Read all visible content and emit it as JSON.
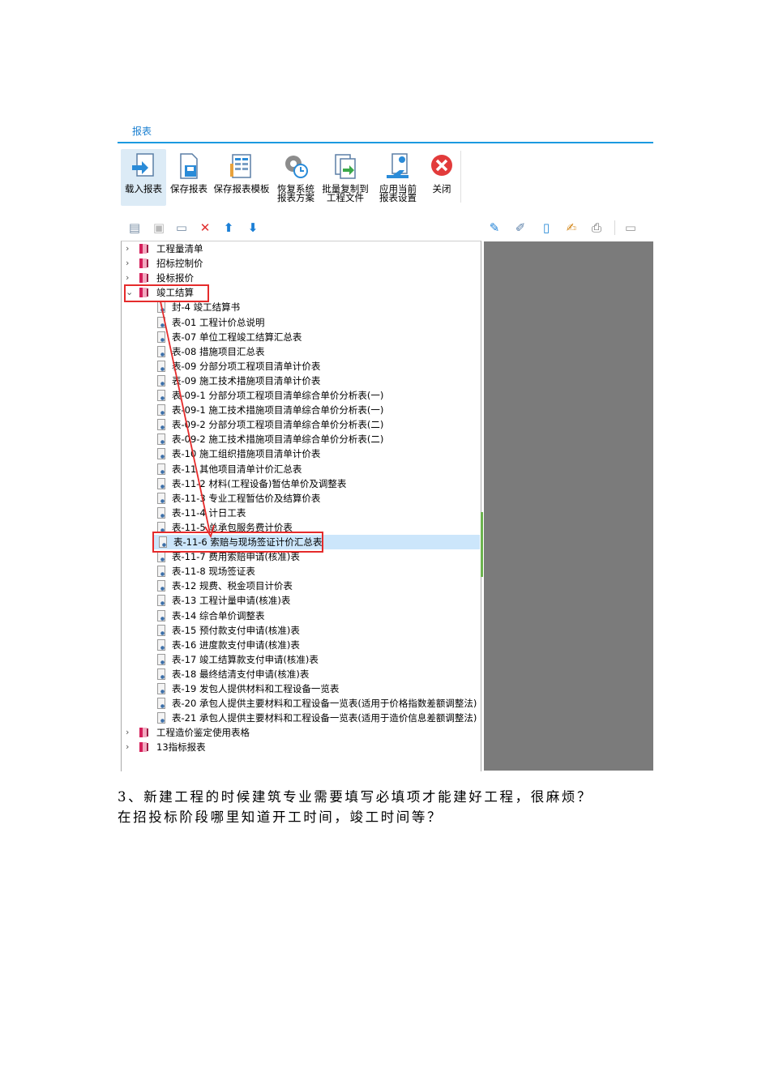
{
  "ribbon": {
    "tab": "报表",
    "buttons": [
      {
        "label1": "载入报表",
        "label2": ""
      },
      {
        "label1": "保存报表",
        "label2": ""
      },
      {
        "label1": "保存报表模板",
        "label2": ""
      },
      {
        "label1": "恢复系统",
        "label2": "报表方案"
      },
      {
        "label1": "批量复制到",
        "label2": "工程文件"
      },
      {
        "label1": "应用当前",
        "label2": "报表设置"
      },
      {
        "label1": "关闭",
        "label2": ""
      }
    ]
  },
  "tree": {
    "top_groups": [
      "工程量清单",
      "招标控制价",
      "投标报价"
    ],
    "expanded_group": "竣工结算",
    "items": [
      "封-4 竣工结算书",
      "表-01 工程计价总说明",
      "表-07 单位工程竣工结算汇总表",
      "表-08 措施项目汇总表",
      "表-09 分部分项工程项目清单计价表",
      "表-09 施工技术措施项目清单计价表",
      "表-09-1 分部分项工程项目清单综合单价分析表(一)",
      "表-09-1 施工技术措施项目清单综合单价分析表(一)",
      "表-09-2 分部分项工程项目清单综合单价分析表(二)",
      "表-09-2 施工技术措施项目清单综合单价分析表(二)",
      "表-10 施工组织措施项目清单计价表",
      "表-11 其他项目清单计价汇总表",
      "表-11-2 材料(工程设备)暂估单价及调整表",
      "表-11-3 专业工程暂估价及结算价表",
      "表-11-4 计日工表",
      "表-11-5 总承包服务费计价表",
      "表-11-6 索赔与现场签证计价汇总表",
      "表-11-7 费用索赔申请(核准)表",
      "表-11-8 现场签证表",
      "表-12 规费、税金项目计价表",
      "表-13 工程计量申请(核准)表",
      "表-14 综合单价调整表",
      "表-15 预付款支付申请(核准)表",
      "表-16 进度款支付申请(核准)表",
      "表-17 竣工结算款支付申请(核准)表",
      "表-18 最终结清支付申请(核准)表",
      "表-19 发包人提供材料和工程设备一览表",
      "表-20 承包人提供主要材料和工程设备一览表(适用于价格指数差额调整法)",
      "表-21 承包人提供主要材料和工程设备一览表(适用于造价信息差额调整法)"
    ],
    "selected_index": 16,
    "bottom_groups": [
      "工程造价鉴定使用表格",
      "13指标报表"
    ]
  },
  "note": {
    "line1": "3、新建工程的时候建筑专业需要填写必填项才能建好工程，很麻烦？",
    "line2": "在招投标阶段哪里知道开工时间，竣工时间等？"
  }
}
